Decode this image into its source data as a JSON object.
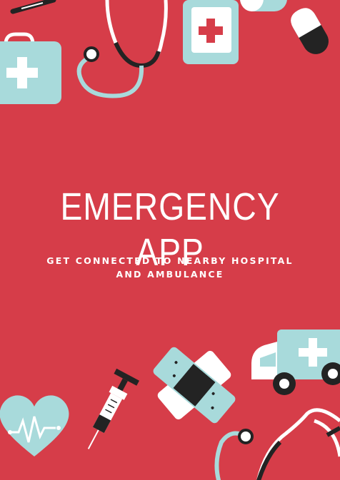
{
  "poster": {
    "title": "EMERGENCY APP",
    "subtitle_line1": "GET CONNECTED TO NEARBY HOSPITAL",
    "subtitle_line2": "AND AMBULANCE"
  },
  "colors": {
    "background": "#d63d49",
    "mint": "#a8dadb",
    "dark": "#232323",
    "white": "#ffffff",
    "red_cross": "#d63d49"
  },
  "icons": [
    "thermometer-icon",
    "stethoscope-icon",
    "first-aid-kit-icon",
    "medicine-bottle-icon",
    "capsule-icon",
    "heart-rate-icon",
    "syringe-icon",
    "bandage-icon",
    "ambulance-icon"
  ]
}
